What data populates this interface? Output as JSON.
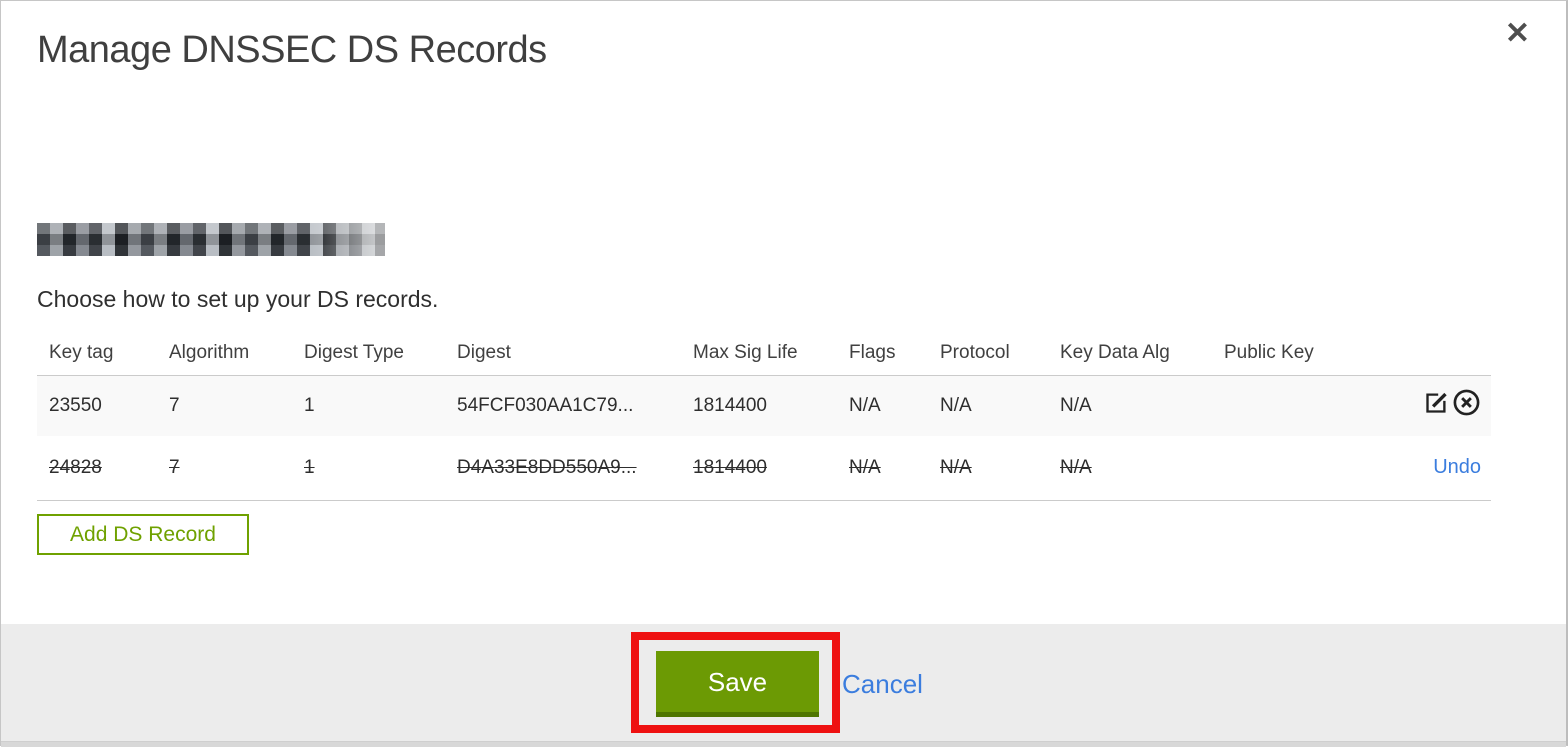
{
  "modal": {
    "title": "Manage DNSSEC DS Records",
    "close_icon": "close-icon",
    "close_glyph": "✕",
    "domain_redacted": true,
    "subtitle": "Choose how to set up your DS records."
  },
  "table": {
    "columns": [
      "Key tag",
      "Algorithm",
      "Digest Type",
      "Digest",
      "Max Sig Life",
      "Flags",
      "Protocol",
      "Key Data Alg",
      "Public Key"
    ],
    "rows": [
      {
        "key_tag": "23550",
        "algorithm": "7",
        "digest_type": "1",
        "digest": "54FCF030AA1C79...",
        "max_sig_life": "1814400",
        "flags": "N/A",
        "protocol": "N/A",
        "key_data_alg": "N/A",
        "public_key": "",
        "deleted": false,
        "actions": [
          "edit-icon",
          "circle-x-icon"
        ]
      },
      {
        "key_tag": "24828",
        "algorithm": "7",
        "digest_type": "1",
        "digest": "D4A33E8DD550A9...",
        "max_sig_life": "1814400",
        "flags": "N/A",
        "protocol": "N/A",
        "key_data_alg": "N/A",
        "public_key": "",
        "deleted": true,
        "actions": [
          "undo-link"
        ]
      }
    ],
    "undo_label": "Undo"
  },
  "buttons": {
    "add_ds_record": "Add DS Record",
    "save": "Save",
    "cancel": "Cancel"
  },
  "annotation": {
    "type": "highlight-rectangle",
    "target": "save-button",
    "color": "#ee1111"
  },
  "colors": {
    "save_green": "#6c9a04",
    "save_green_dark": "#4e7500",
    "outline_green": "#6fa100",
    "link_blue": "#3b7dde",
    "footer_bg": "#ececec"
  }
}
